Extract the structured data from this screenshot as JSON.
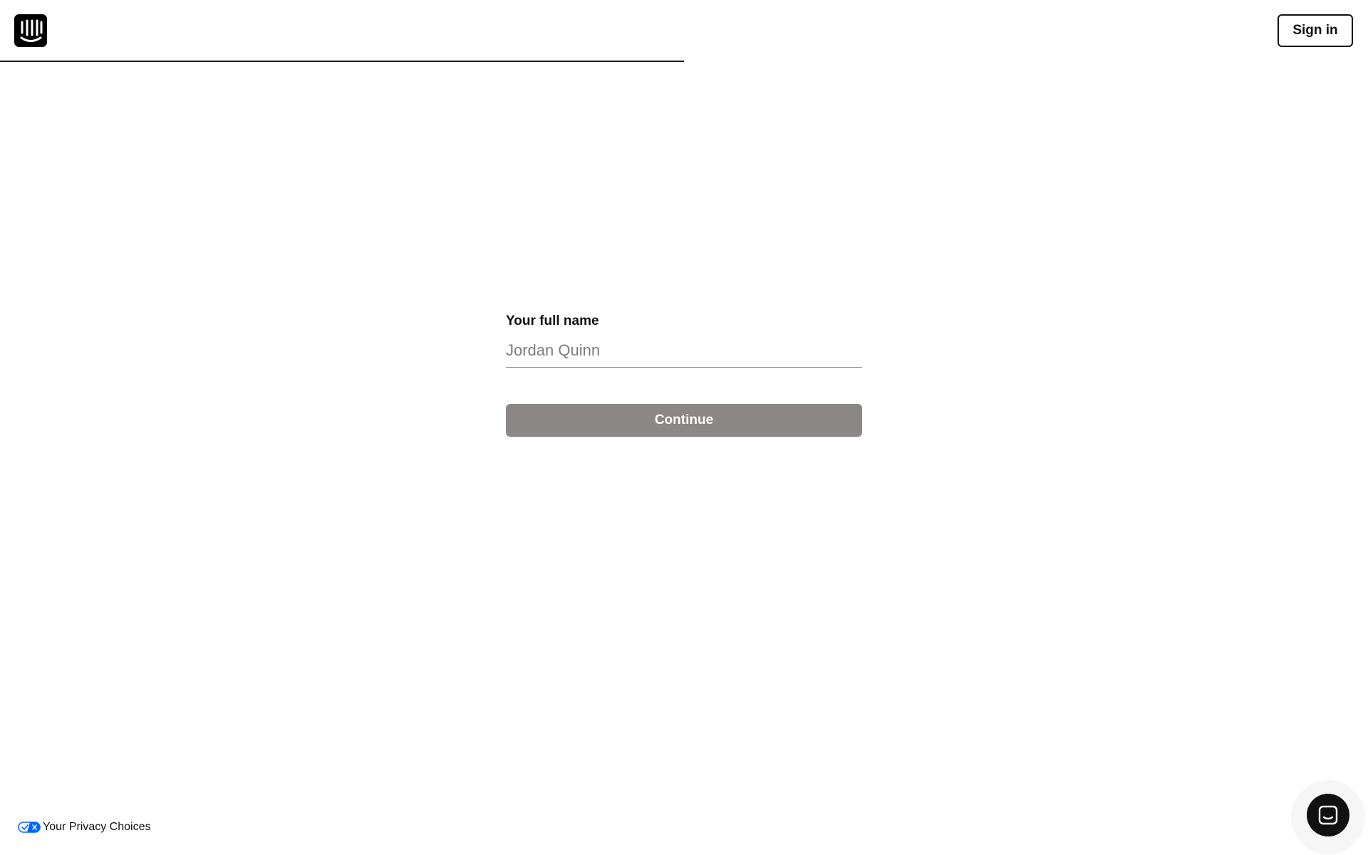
{
  "header": {
    "logo_icon": "intercom-logo-icon",
    "signin_label": "Sign in",
    "progress": 0.5
  },
  "form": {
    "label": "Your full name",
    "input_value": "",
    "input_placeholder": "Jordan Quinn",
    "continue_label": "Continue",
    "continue_color": "#8b8786"
  },
  "footer": {
    "privacy_label": "Your Privacy Choices",
    "privacy_icon": "privacy-toggle-icon",
    "privacy_icon_color": "#0066ff"
  },
  "chat": {
    "launcher_icon": "chat-icon"
  }
}
